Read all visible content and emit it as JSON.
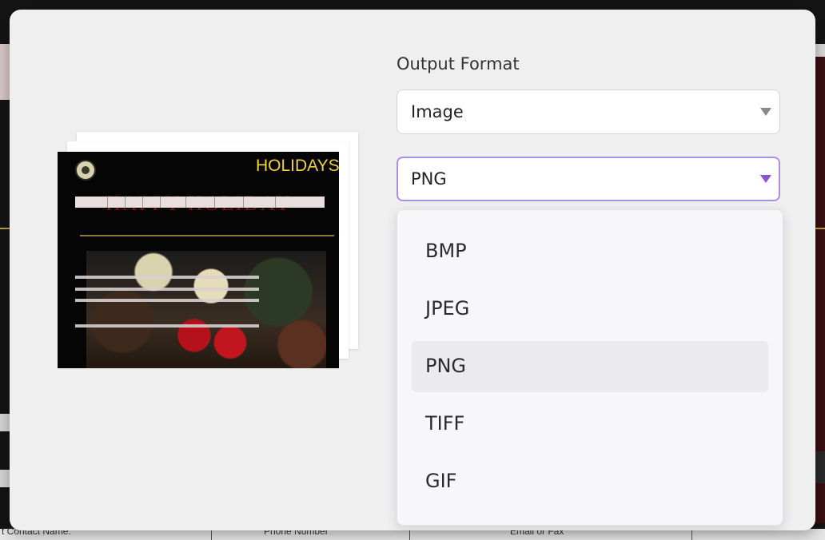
{
  "background": {
    "bottom_labels": [
      "t Contact Name:",
      "Phone Number",
      "Email or Fax"
    ]
  },
  "preview": {
    "thumbnail_title": "HOLIDAYS",
    "thumbnail_script": "HAPPY HOLIDAY"
  },
  "output_format": {
    "label": "Output Format",
    "type_select": {
      "value": "Image"
    },
    "format_select": {
      "value": "PNG"
    },
    "options": [
      "BMP",
      "JPEG",
      "PNG",
      "TIFF",
      "GIF"
    ],
    "selected": "PNG"
  },
  "colors": {
    "accent_border": "#b18ee6",
    "accent_caret": "#8a52d8",
    "modal_bg": "#efeff0"
  }
}
